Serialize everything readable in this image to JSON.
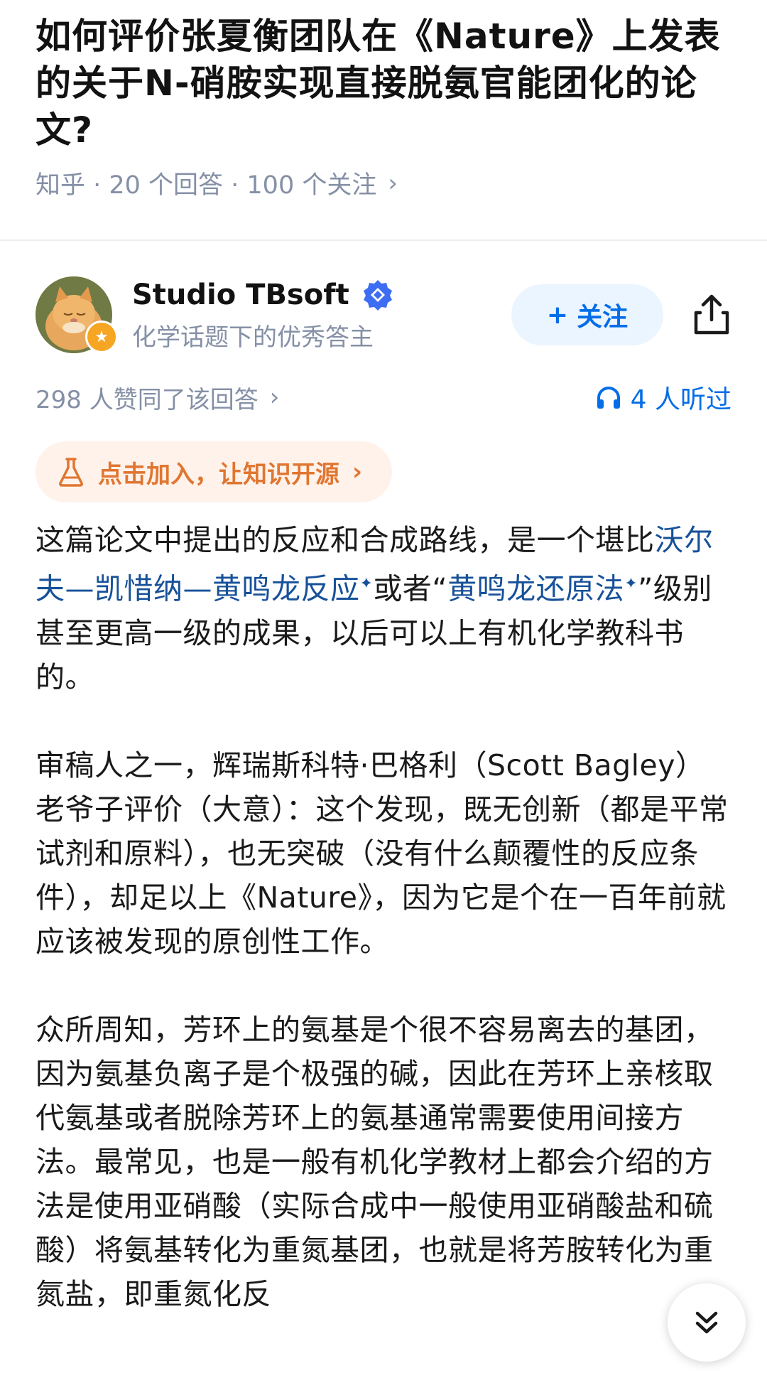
{
  "question": {
    "title": "如何评价张夏衡团队在《Nature》上发表的关于N-硝胺实现直接脱氨官能团化的论文?",
    "meta": "知乎 · 20 个回答 · 100 个关注",
    "chevron": "›"
  },
  "author": {
    "name": "Studio TBsoft",
    "subtitle": "化学话题下的优秀答主",
    "follow_label": "关注",
    "follow_plus": "+"
  },
  "stats": {
    "likes": "298 人赞同了该回答",
    "likes_chevron": "›",
    "listeners": "4 人听过"
  },
  "join": {
    "label": "点击加入，让知识开源",
    "chevron": "›"
  },
  "content": {
    "p1_a": "这篇论文中提出的反应和合成路线，是一个堪比",
    "p1_link1": "沃尔夫—凯惜纳—黄鸣龙反应",
    "p1_b": "或者“",
    "p1_link2": "黄鸣龙还原法",
    "p1_c": "”级别甚至更高一级的成果，以后可以上有机化学教科书的。",
    "p2": "审稿人之一，辉瑞斯科特·巴格利（Scott Bagley）老爷子评价（大意）：这个发现，既无创新（都是平常试剂和原料），也无突破（没有什么颠覆性的反应条件），却足以上《Nature》，因为它是个在一百年前就应该被发现的原创性工作。",
    "p3": "众所周知，芳环上的氨基是个很不容易离去的基团，因为氨基负离子是个极强的碱，因此在芳环上亲核取代氨基或者脱除芳环上的氨基通常需要使用间接方法。最常见，也是一般有机化学教材上都会介绍的方法是使用亚硝酸（实际合成中一般使用亚硝酸盐和硫酸）将氨基转化为重氮基团，也就是将芳胺转化为重氮盐，即重氮化反",
    "sup_mark": "✦"
  },
  "colors": {
    "accent": "#056de8",
    "link": "#175199",
    "meta_gray": "#8590a6",
    "orange": "#e07631"
  },
  "icons": [
    "verified-icon",
    "share-icon",
    "headphones-icon",
    "flask-icon",
    "double-chevron-down-icon",
    "star-badge-icon"
  ]
}
